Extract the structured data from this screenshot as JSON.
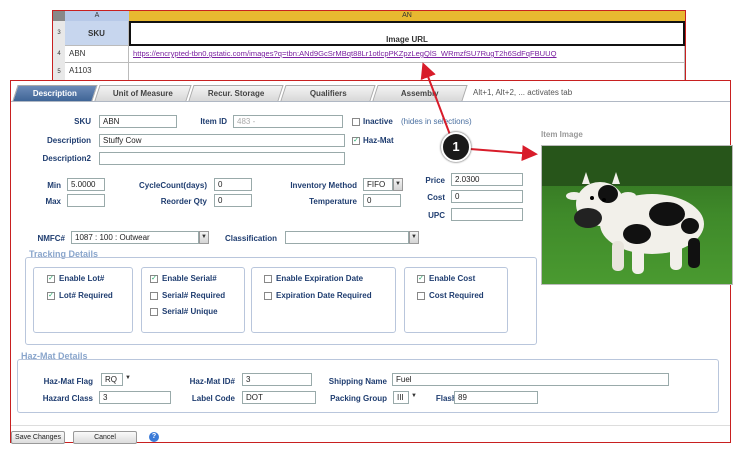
{
  "sheet": {
    "col_a": "A",
    "col_an": "AN",
    "rows": [
      "3",
      "4",
      "5"
    ],
    "header_sku": "SKU",
    "header_image_url": "Image URL",
    "sku_1": "ABN",
    "url_1": "https://encrypted-tbn0.gstatic.com/images?q=tbn:ANd9GcSrMBqt88Lr1otlcpPKZpzLegQlS_WRmzfSU7RugT2h6SdFqFBUUQ",
    "sku_2": "A1103"
  },
  "callout": {
    "number": "1"
  },
  "tabs": [
    {
      "label": "Description"
    },
    {
      "label": "Unit of Measure"
    },
    {
      "label": "Recur. Storage"
    },
    {
      "label": "Qualifiers"
    },
    {
      "label": "Assembly"
    }
  ],
  "tab_hint": "Alt+1, Alt+2, ... activates tab",
  "form": {
    "sku_label": "SKU",
    "sku_value": "ABN",
    "item_id_label": "Item ID",
    "item_id_value": "483  -",
    "inactive_label": "Inactive",
    "inactive_hint": "(hides in selections)",
    "hazmat_label": "Haz-Mat",
    "description_label": "Description",
    "description_value": "Stuffy Cow",
    "description2_label": "Description2",
    "description2_value": "",
    "min_label": "Min",
    "min_value": "5.0000",
    "max_label": "Max",
    "max_value": "",
    "cycle_label": "CycleCount(days)",
    "cycle_value": "0",
    "reorder_label": "Reorder Qty",
    "reorder_value": "0",
    "inv_method_label": "Inventory Method",
    "inv_method_value": "FIFO",
    "temperature_label": "Temperature",
    "temperature_value": "0",
    "price_label": "Price",
    "price_value": "2.0300",
    "cost_label": "Cost",
    "cost_value": "0",
    "upc_label": "UPC",
    "upc_value": "",
    "nmfc_label": "NMFC#",
    "nmfc_value": "1087 : 100 : Outwear",
    "classification_label": "Classification",
    "classification_value": "",
    "item_image_label": "Item Image"
  },
  "tracking": {
    "title": "Tracking Details",
    "enable_lot": "Enable Lot#",
    "lot_required": "Lot# Required",
    "enable_serial": "Enable Serial#",
    "serial_required": "Serial# Required",
    "serial_unique": "Serial# Unique",
    "enable_expiration": "Enable Expiration Date",
    "expiration_required": "Expiration Date Required",
    "enable_cost": "Enable Cost",
    "cost_required": "Cost Required",
    "checked": [
      "enable_lot",
      "lot_required",
      "enable_serial",
      "enable_cost"
    ]
  },
  "hazmat": {
    "title": "Haz-Mat Details",
    "flag_label": "Haz-Mat Flag",
    "flag_value": "RQ",
    "id_label": "Haz-Mat ID#",
    "id_value": "3",
    "shipping_name_label": "Shipping Name",
    "shipping_name_value": "Fuel",
    "hazard_class_label": "Hazard Class",
    "hazard_class_value": "3",
    "label_code_label": "Label Code",
    "label_code_value": "DOT",
    "packing_group_label": "Packing Group",
    "packing_group_value": "III",
    "flash_point_label": "Flash Point",
    "flash_point_value": "89"
  },
  "footer": {
    "save_label": "Save Changes",
    "cancel_label": "Cancel"
  },
  "colors": {
    "accent_red": "#c82020",
    "tab_active": "#4a6fa0",
    "label_blue": "#1f3d70",
    "section_blue": "#8aa6cc",
    "spreadsheet_header": "#f0c020"
  },
  "icons": [
    "help-icon",
    "dropdown-arrow-icon",
    "checkbox-check-icon",
    "callout-marker"
  ]
}
